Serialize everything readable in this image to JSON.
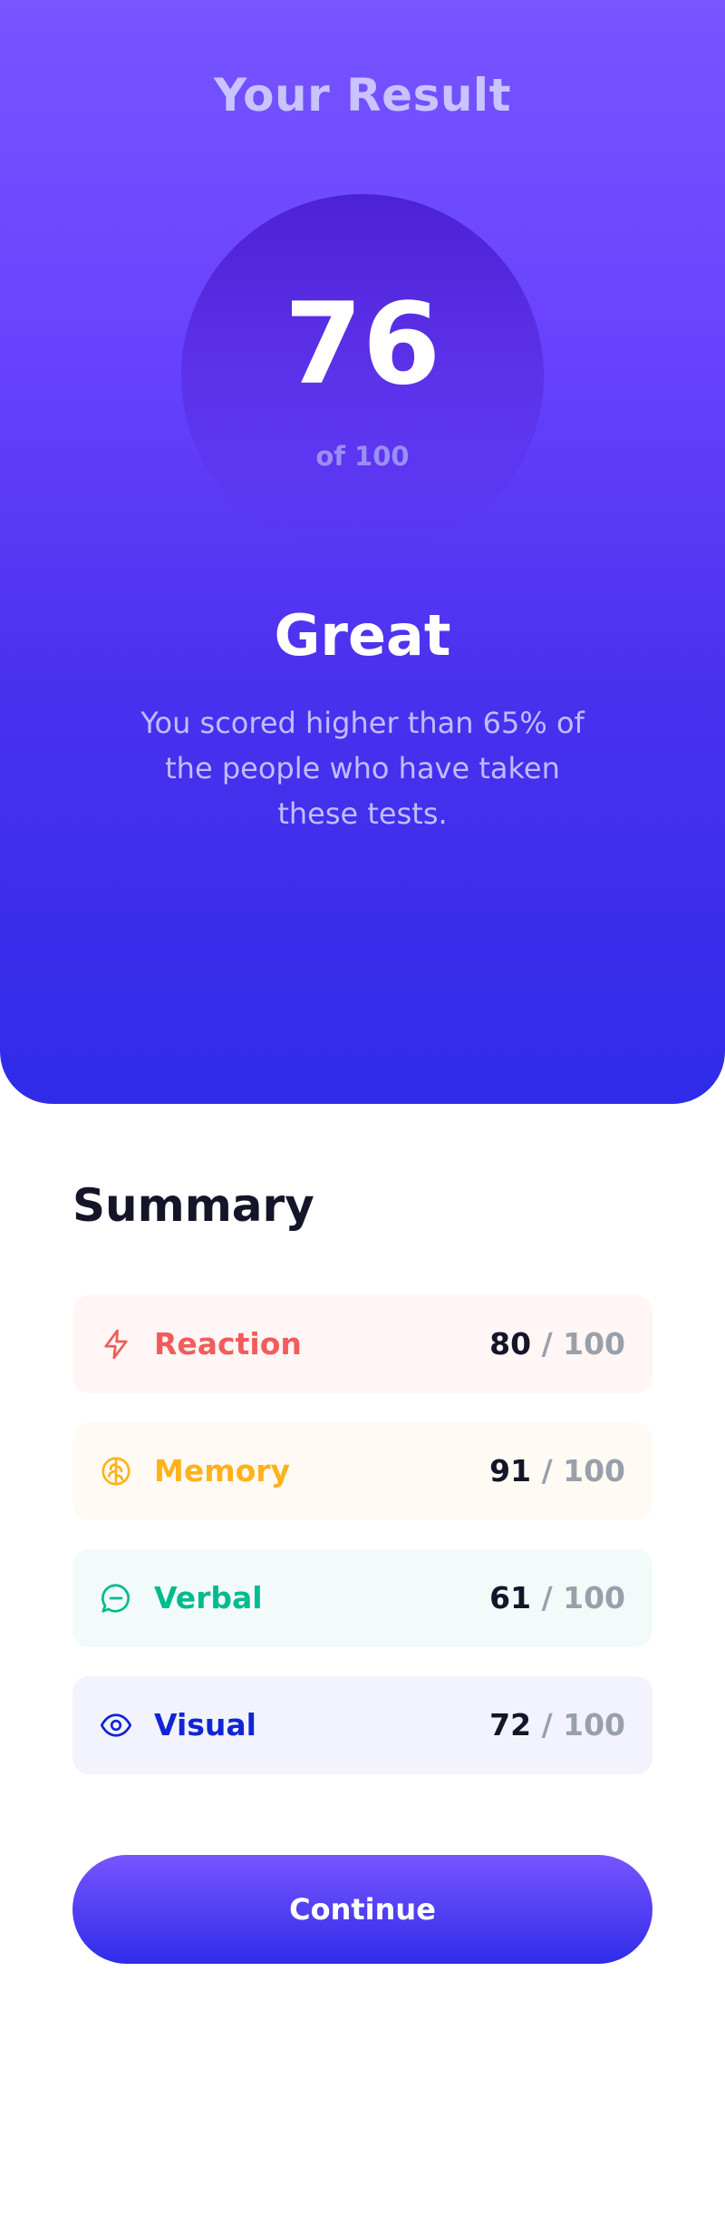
{
  "result": {
    "title": "Your Result",
    "score": "76",
    "max": "of 100",
    "grade": "Great",
    "description": "You scored higher than 65% of the people who have taken these tests."
  },
  "summary": {
    "title": "Summary",
    "items": [
      {
        "label": "Reaction",
        "score": "80",
        "max": " / 100",
        "icon": "lightning-icon",
        "color": "#f25c5c",
        "bg": "#fff6f5"
      },
      {
        "label": "Memory",
        "score": "91",
        "max": " / 100",
        "icon": "brain-icon",
        "color": "#ffb21e",
        "bg": "#fffbf4"
      },
      {
        "label": "Verbal",
        "score": "61",
        "max": " / 100",
        "icon": "chat-bubble-icon",
        "color": "#00bb8f",
        "bg": "#f2fbfa"
      },
      {
        "label": "Visual",
        "score": "72",
        "max": " / 100",
        "icon": "eye-icon",
        "color": "#1125d6",
        "bg": "#f3f3fd"
      }
    ]
  },
  "continue_label": "Continue",
  "colors": {
    "gradient_top": "#7755ff",
    "gradient_bottom": "#2f2ce9",
    "circle_top": "#4d21d4"
  }
}
